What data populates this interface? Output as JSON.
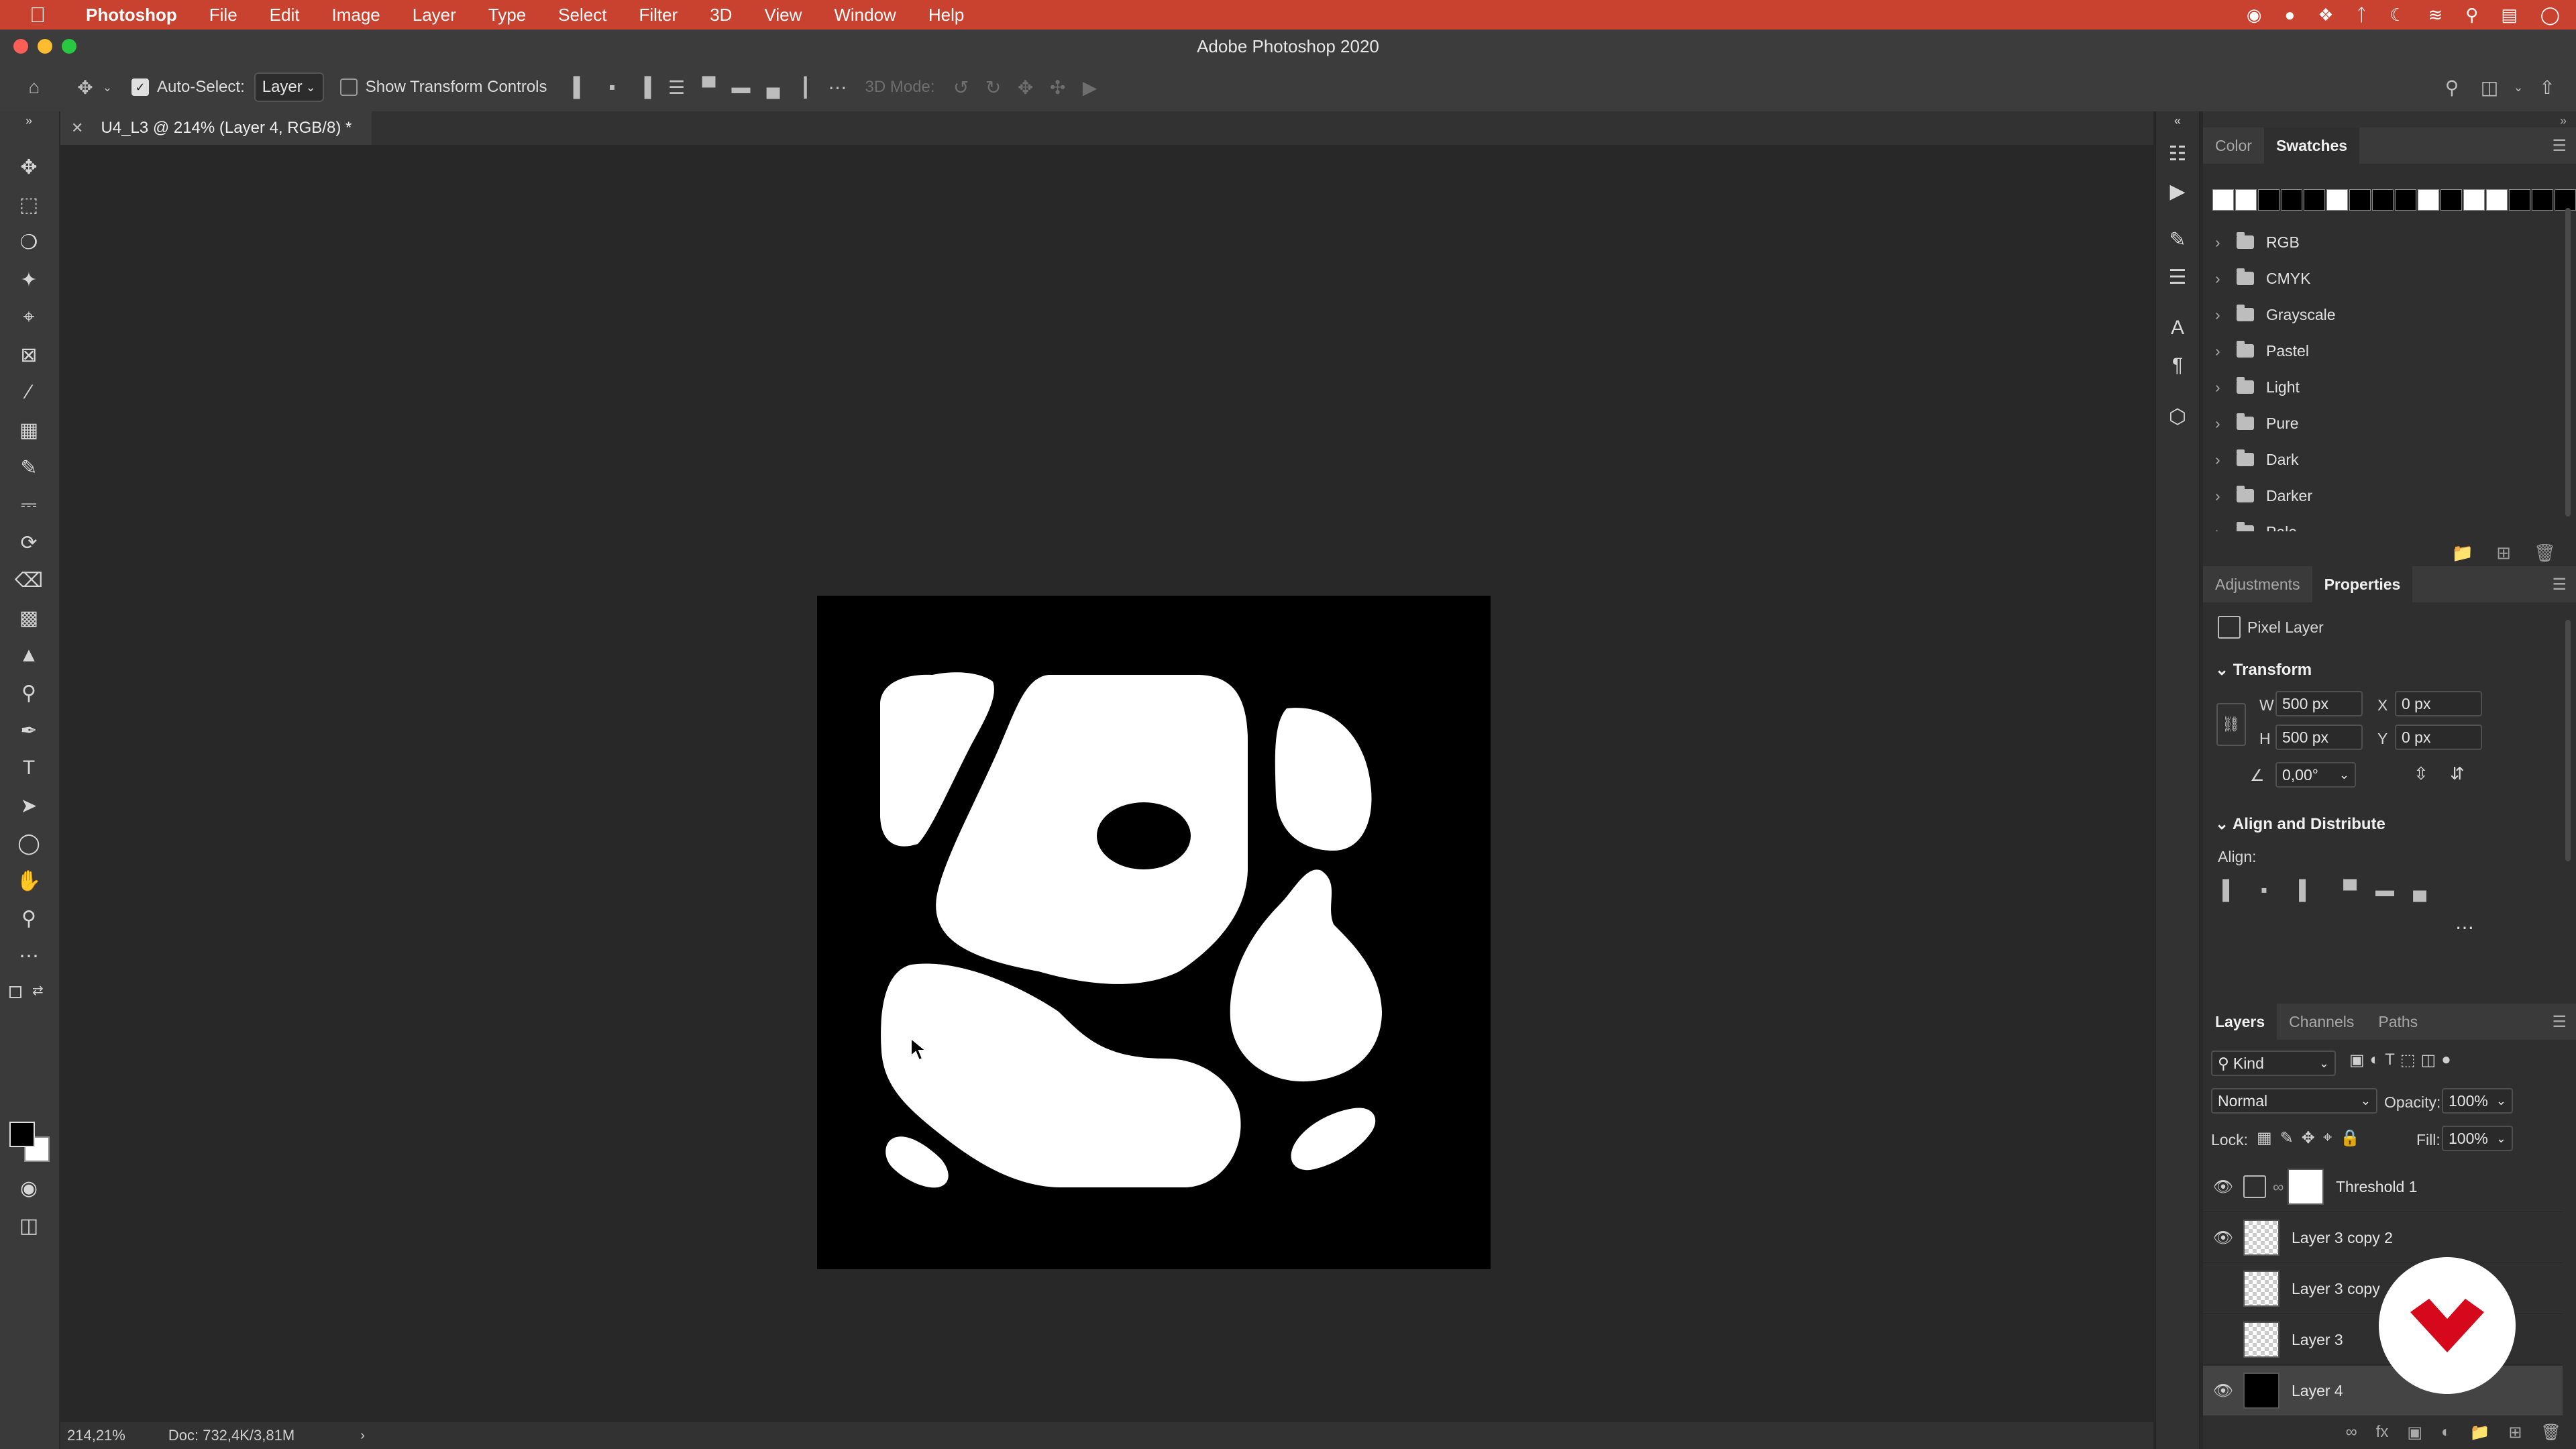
{
  "menubar": {
    "app": "Photoshop",
    "items": [
      "File",
      "Edit",
      "Image",
      "Layer",
      "Type",
      "Select",
      "Filter",
      "3D",
      "View",
      "Window",
      "Help"
    ]
  },
  "window": {
    "title": "Adobe Photoshop 2020"
  },
  "options": {
    "auto_select_label": "Auto-Select:",
    "auto_select_value": "Layer",
    "transform_label": "Show Transform Controls",
    "mode_3d_label": "3D Mode:"
  },
  "document": {
    "tab_title": "U4_L3 @ 214% (Layer 4, RGB/8) *"
  },
  "status": {
    "zoom": "214,21%",
    "doc": "Doc: 732,4K/3,81M"
  },
  "swatches_panel": {
    "tabs": [
      "Color",
      "Swatches"
    ],
    "active_tab": "Swatches",
    "folders": [
      "RGB",
      "CMYK",
      "Grayscale",
      "Pastel",
      "Light",
      "Pure",
      "Dark",
      "Darker",
      "Pale"
    ],
    "swatch_colors": [
      "#ffffff",
      "#ffffff",
      "#000000",
      "#000000",
      "#000000",
      "#ffffff",
      "#000000",
      "#000000",
      "#000000",
      "#ffffff",
      "#000000",
      "#ffffff",
      "#ffffff",
      "#000000",
      "#000000",
      "#000000",
      "#ffffff"
    ]
  },
  "properties_panel": {
    "tabs": [
      "Adjustments",
      "Properties"
    ],
    "active_tab": "Properties",
    "layer_type": "Pixel Layer",
    "transform_title": "Transform",
    "w_label": "W",
    "w_value": "500 px",
    "h_label": "H",
    "h_value": "500 px",
    "x_label": "X",
    "x_value": "0 px",
    "y_label": "Y",
    "y_value": "0 px",
    "angle_value": "0,00°",
    "align_title": "Align and Distribute",
    "align_label": "Align:"
  },
  "layers_panel": {
    "tabs": [
      "Layers",
      "Channels",
      "Paths"
    ],
    "active_tab": "Layers",
    "filter_label": "Kind",
    "blend_mode": "Normal",
    "opacity_label": "Opacity:",
    "opacity_value": "100%",
    "lock_label": "Lock:",
    "fill_label": "Fill:",
    "fill_value": "100%",
    "layers": [
      {
        "name": "Threshold 1",
        "visible": true
      },
      {
        "name": "Layer 3 copy 2",
        "visible": true
      },
      {
        "name": "Layer 3 copy",
        "visible": false
      },
      {
        "name": "Layer 3",
        "visible": false
      },
      {
        "name": "Layer 4",
        "visible": true
      }
    ]
  },
  "colors": {
    "menubar": "#c9412f",
    "accent_watermark": "#d6081b"
  }
}
